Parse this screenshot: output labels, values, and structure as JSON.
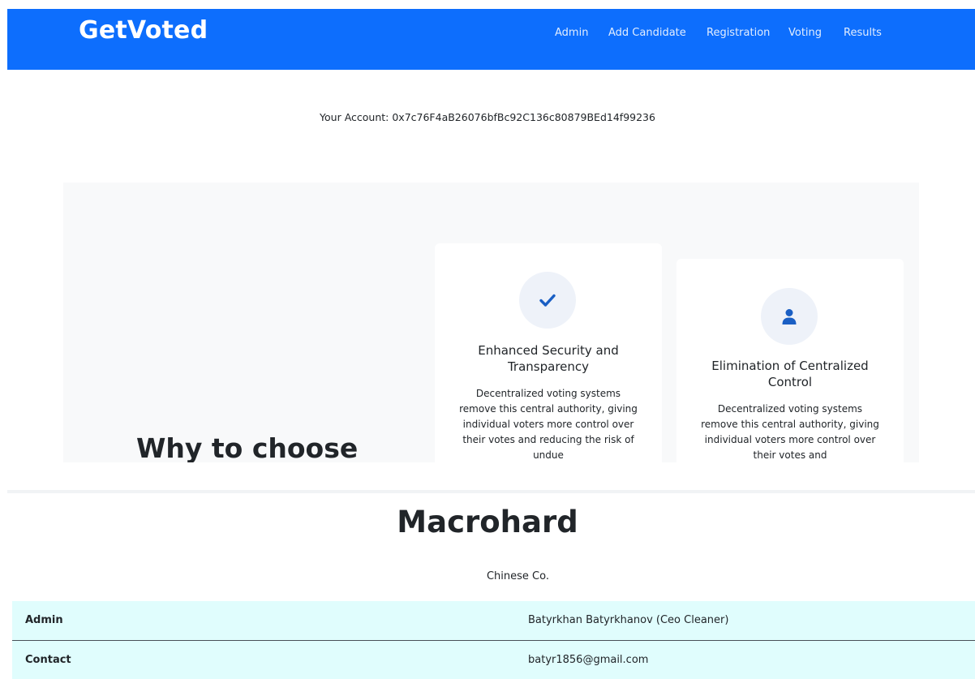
{
  "header": {
    "brand": "GetVoted",
    "nav": [
      "Admin",
      "Add Candidate",
      "Registration",
      "Voting",
      "Results"
    ]
  },
  "account": {
    "text": "Your Account: 0x7c76F4aB26076bfBc92C136c80879BEd14f99236"
  },
  "features": {
    "heading": "Why to choose",
    "cards": [
      {
        "icon": "check-icon",
        "title": "Enhanced Security and Transparency",
        "text": "Decentralized voting systems remove this central authority, giving individual voters more control over their votes and reducing the risk of undue"
      },
      {
        "icon": "user-icon",
        "title": "Elimination of Centralized Control",
        "text": "Decentralized voting systems remove this central authority, giving individual voters more control over their votes and"
      }
    ]
  },
  "organization": {
    "name": "Macrohard",
    "subtitle": "Chinese Co.",
    "rows": [
      {
        "label": "Admin",
        "value": "Batyrkhan Batyrkhanov (Ceo Cleaner)"
      },
      {
        "label": "Contact",
        "value": "batyr1856@gmail.com"
      }
    ]
  },
  "colors": {
    "primary": "#0d6efd",
    "section_bg": "#f8f9fa",
    "row_bg": "#e0fdfd",
    "icon_blue": "#1a5fc4"
  }
}
